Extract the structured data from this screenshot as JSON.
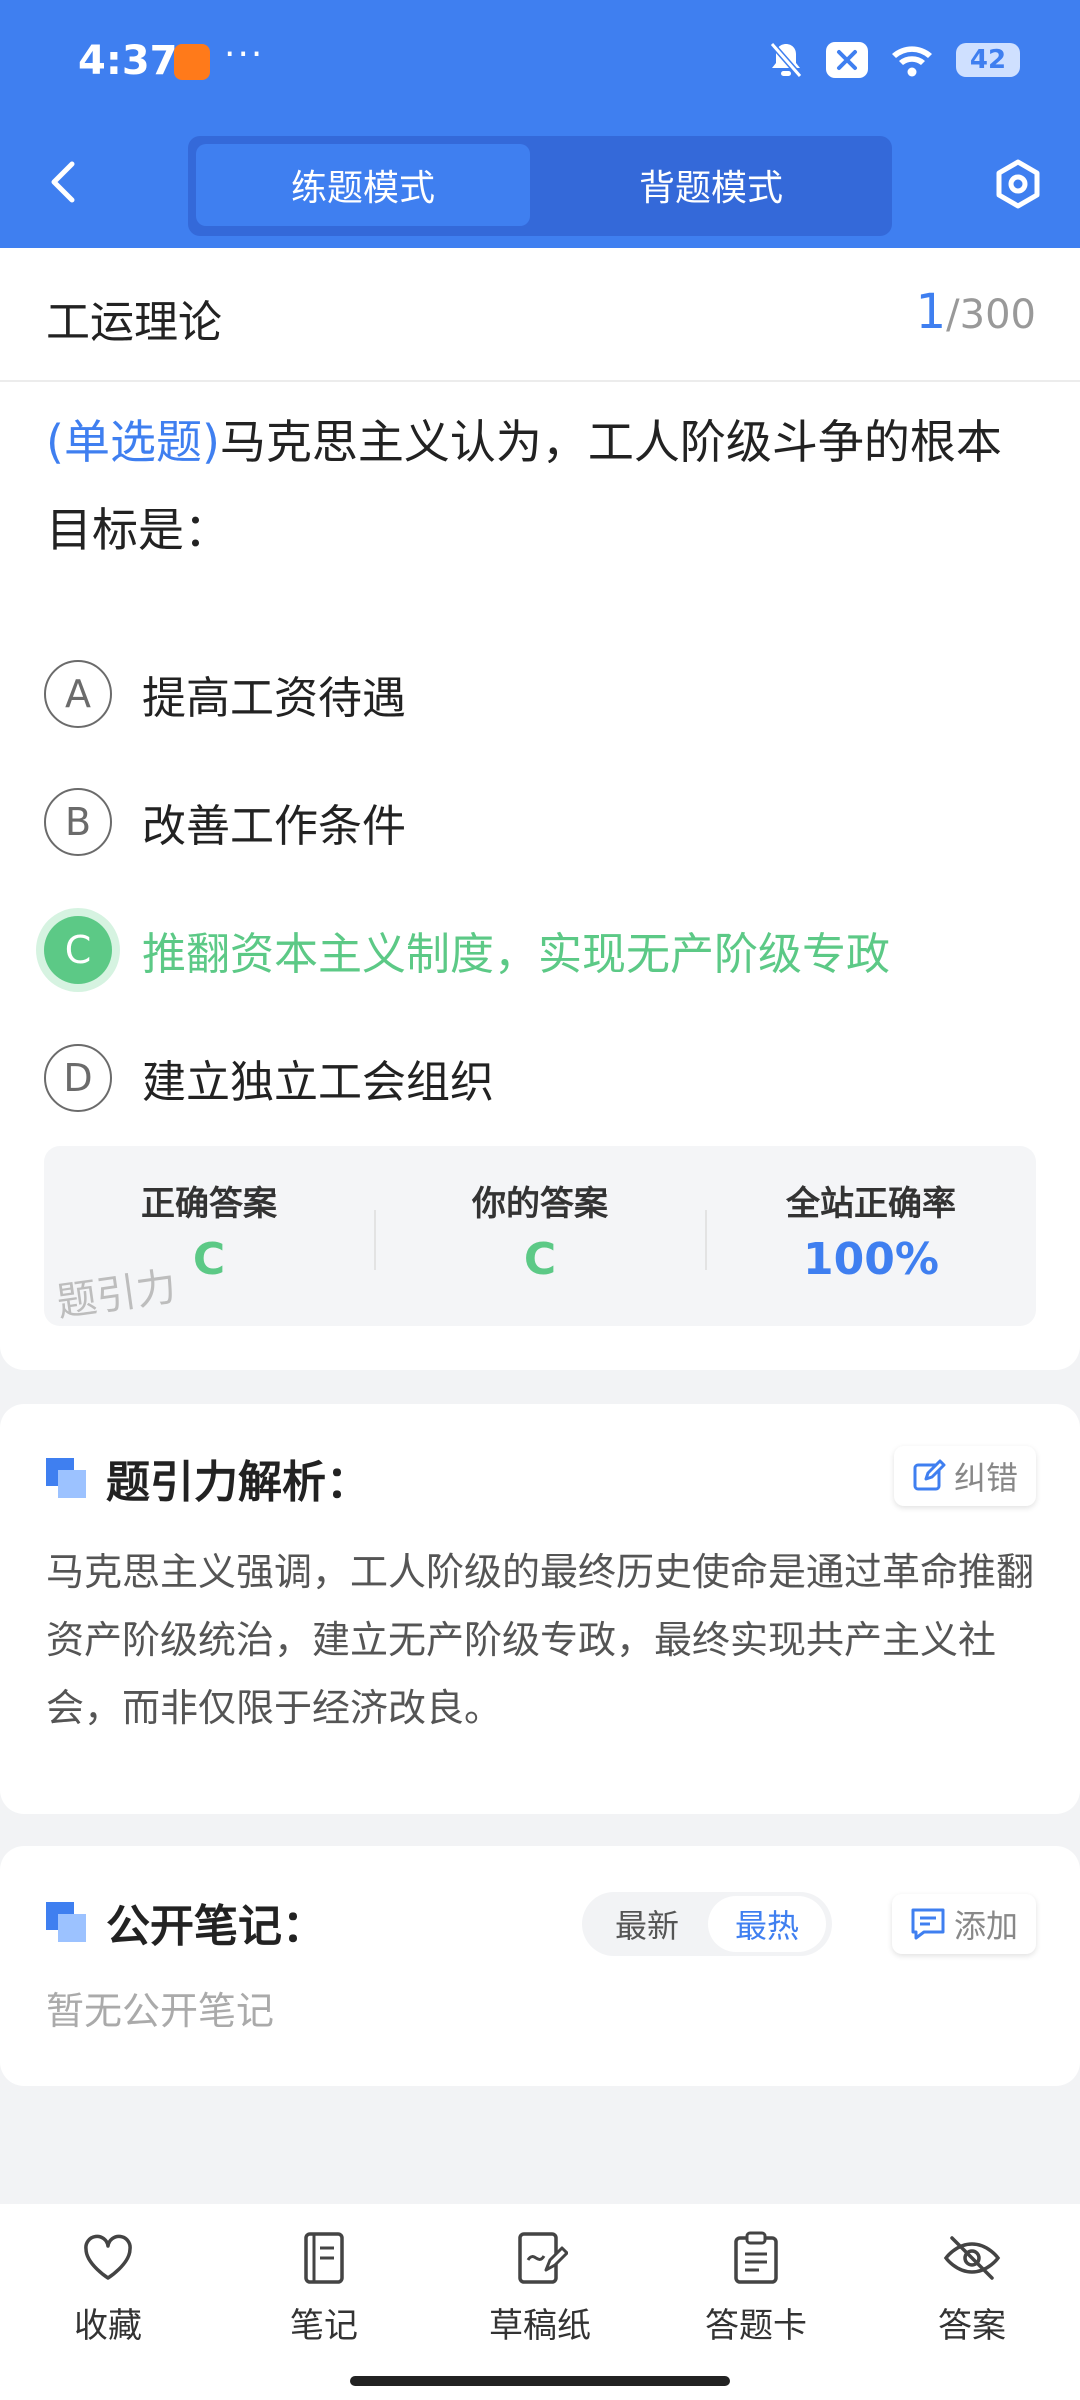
{
  "status_bar": {
    "time": "4:37",
    "dots": "···",
    "battery": "42"
  },
  "header": {
    "modes": [
      "练题模式",
      "背题模式"
    ],
    "active_mode": "练题模式"
  },
  "question": {
    "subject": "工运理论",
    "current": "1",
    "total": "/300",
    "type": "(单选题)",
    "text": "马克思主义认为，工人阶级斗争的根本目标是：",
    "options": [
      {
        "letter": "A",
        "text": "提高工资待遇"
      },
      {
        "letter": "B",
        "text": "改善工作条件"
      },
      {
        "letter": "C",
        "text": "推翻资本主义制度，实现无产阶级专政"
      },
      {
        "letter": "D",
        "text": "建立独立工会组织"
      }
    ],
    "correct_option": "C"
  },
  "answer_stats": {
    "correct_label": "正确答案",
    "correct_value": "C",
    "yours_label": "你的答案",
    "yours_value": "C",
    "rate_label": "全站正确率",
    "rate_value": "100%",
    "watermark": "题引力"
  },
  "analysis": {
    "title": "题引力解析：",
    "report_label": "纠错",
    "text": "马克思主义强调，工人阶级的最终历史使命是通过革命推翻资产阶级统治，建立无产阶级专政，最终实现共产主义社会，而非仅限于经济改良。"
  },
  "notes": {
    "title": "公开笔记：",
    "sort_options": [
      "最新",
      "最热"
    ],
    "active_sort": "最热",
    "add_label": "添加",
    "empty_text": "暂无公开笔记"
  },
  "bottom_nav": [
    {
      "label": "收藏",
      "icon": "heart-icon"
    },
    {
      "label": "笔记",
      "icon": "notebook-icon"
    },
    {
      "label": "草稿纸",
      "icon": "draft-icon"
    },
    {
      "label": "答题卡",
      "icon": "answer-card-icon"
    },
    {
      "label": "答案",
      "icon": "eye-off-icon"
    }
  ],
  "colors": {
    "primary": "#3f7ff0",
    "correct": "#5cc986"
  }
}
